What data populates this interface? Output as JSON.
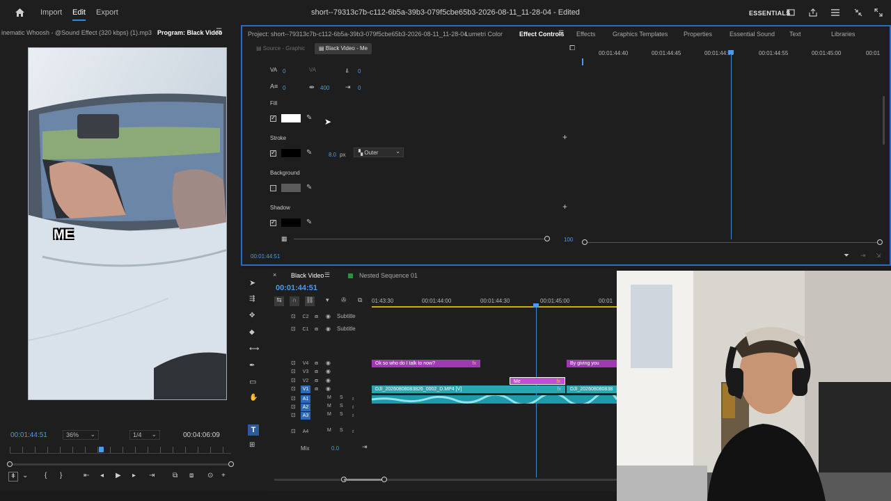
{
  "topbar": {
    "nav": [
      "Import",
      "Edit",
      "Export"
    ],
    "title": "short--79313c7b-c112-6b5a-39b3-079f5cbe65b3-2026-08-11_11-28-04 - Edited",
    "essentials": "ESSENTIALS"
  },
  "program": {
    "source_tab": "inematic Whoosh - @Sound Effect (320 kbps) (1).mp3",
    "tab": "Program: Black Video",
    "caption": "ME",
    "timecode": "00:01:44:51",
    "zoom": "36%",
    "resolution": "1/4",
    "duration": "00:04:06:09"
  },
  "effect_panel": {
    "project_tab": "Project: short--79313c7b-c112-6b5a-39b3-079f5cbe65b3-2026-08-11_11-28-04",
    "tabs": [
      "Lumetri Color",
      "Effect Controls",
      "Effects",
      "Graphics Templates",
      "Properties",
      "Essential Sound",
      "Text",
      "Libraries"
    ],
    "subtabs": [
      "Source - Graphic",
      "Black Video - Me"
    ],
    "values": {
      "tracking": "0",
      "kerning": "0",
      "leading": "0",
      "baseline": "0",
      "tsume": "400",
      "indent": "0"
    },
    "fill_label": "Fill",
    "stroke_label": "Stroke",
    "stroke_width": "8.0",
    "stroke_unit": "px",
    "stroke_type": "Outer",
    "background_label": "Background",
    "shadow_label": "Shadow",
    "opacity_value": "100",
    "timecode": "00:01:44:51",
    "ruler": [
      "00:01:44:40",
      "00:01:44:45",
      "00:01:44:50",
      "00:01:44:55",
      "00:01:45:00",
      "00:01"
    ],
    "fill_color": "#ffffff",
    "stroke_color": "#000000"
  },
  "timeline": {
    "tabs": [
      "Black Video",
      "Nested Sequence 01"
    ],
    "timecode": "00:01:44:51",
    "ruler": [
      "01:43:30",
      "00:01:44:00",
      "00:01:44:30",
      "00:01:45:00",
      "00:01"
    ],
    "tracks": [
      {
        "id": "C2",
        "name": "Subtitle"
      },
      {
        "id": "C1",
        "name": "Subtitle"
      },
      {
        "id": "V4",
        "name": ""
      },
      {
        "id": "V3",
        "name": ""
      },
      {
        "id": "V2",
        "name": ""
      },
      {
        "id": "V1",
        "name": ""
      },
      {
        "id": "A1",
        "name": ""
      },
      {
        "id": "A2",
        "name": ""
      },
      {
        "id": "A3",
        "name": ""
      },
      {
        "id": "A4",
        "name": ""
      }
    ],
    "mix_label": "Mix",
    "mix_value": "0.0",
    "clips": {
      "v4_a": "Ok so who do I talk to now?",
      "v4_b": "By giving you",
      "v2_a": "Me",
      "v1_a": "DJI_20260808083826_0002_D.MP4 [V]",
      "v1_b": "DJI_202608080838"
    }
  },
  "colors": {
    "accent": "#2d8ceb",
    "clip_purple": "#a03ab4",
    "clip_teal": "#2aa5b3",
    "audio_teal": "#1f9aa8"
  }
}
